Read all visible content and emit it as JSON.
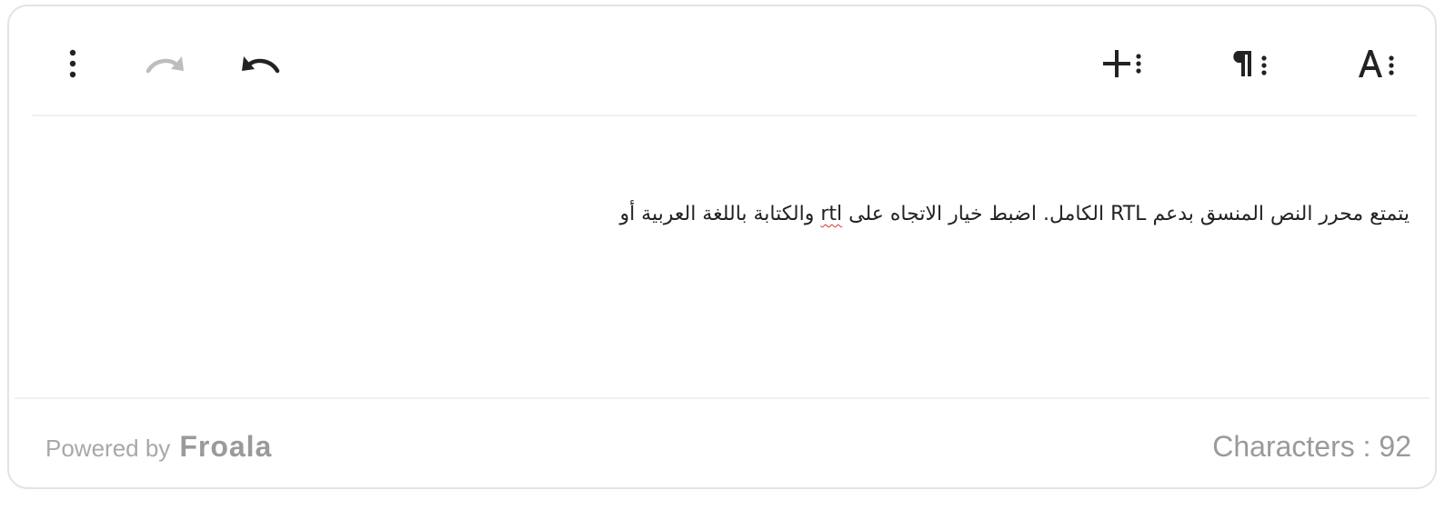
{
  "toolbar": {
    "left": [
      {
        "name": "more-options",
        "icon": "kebab-vertical-icon",
        "enabled": true
      },
      {
        "name": "redo",
        "icon": "redo-icon",
        "enabled": false
      },
      {
        "name": "undo",
        "icon": "undo-icon",
        "enabled": true
      }
    ],
    "right": [
      {
        "name": "insert-more",
        "icon": "plus-more-icon",
        "glyph": "+"
      },
      {
        "name": "paragraph-more",
        "icon": "paragraph-more-icon",
        "glyph": "¶"
      },
      {
        "name": "text-more",
        "icon": "text-format-more-icon",
        "glyph": "A"
      }
    ]
  },
  "editor": {
    "content_before": "يتمتع محرر النص المنسق بدعم RTL الكامل. اضبط خيار الاتجاه على ",
    "content_highlight": "rtl",
    "content_after": " والكتابة باللغة العربية أو"
  },
  "footer": {
    "powered_by_label": "Powered by",
    "brand": "Froala",
    "char_count_label": "Characters : 92"
  },
  "colors": {
    "icon_active": "#222222",
    "icon_disabled": "#bdbdbd",
    "footer_text": "#9a9a9a",
    "border": "#e3e3e3"
  }
}
